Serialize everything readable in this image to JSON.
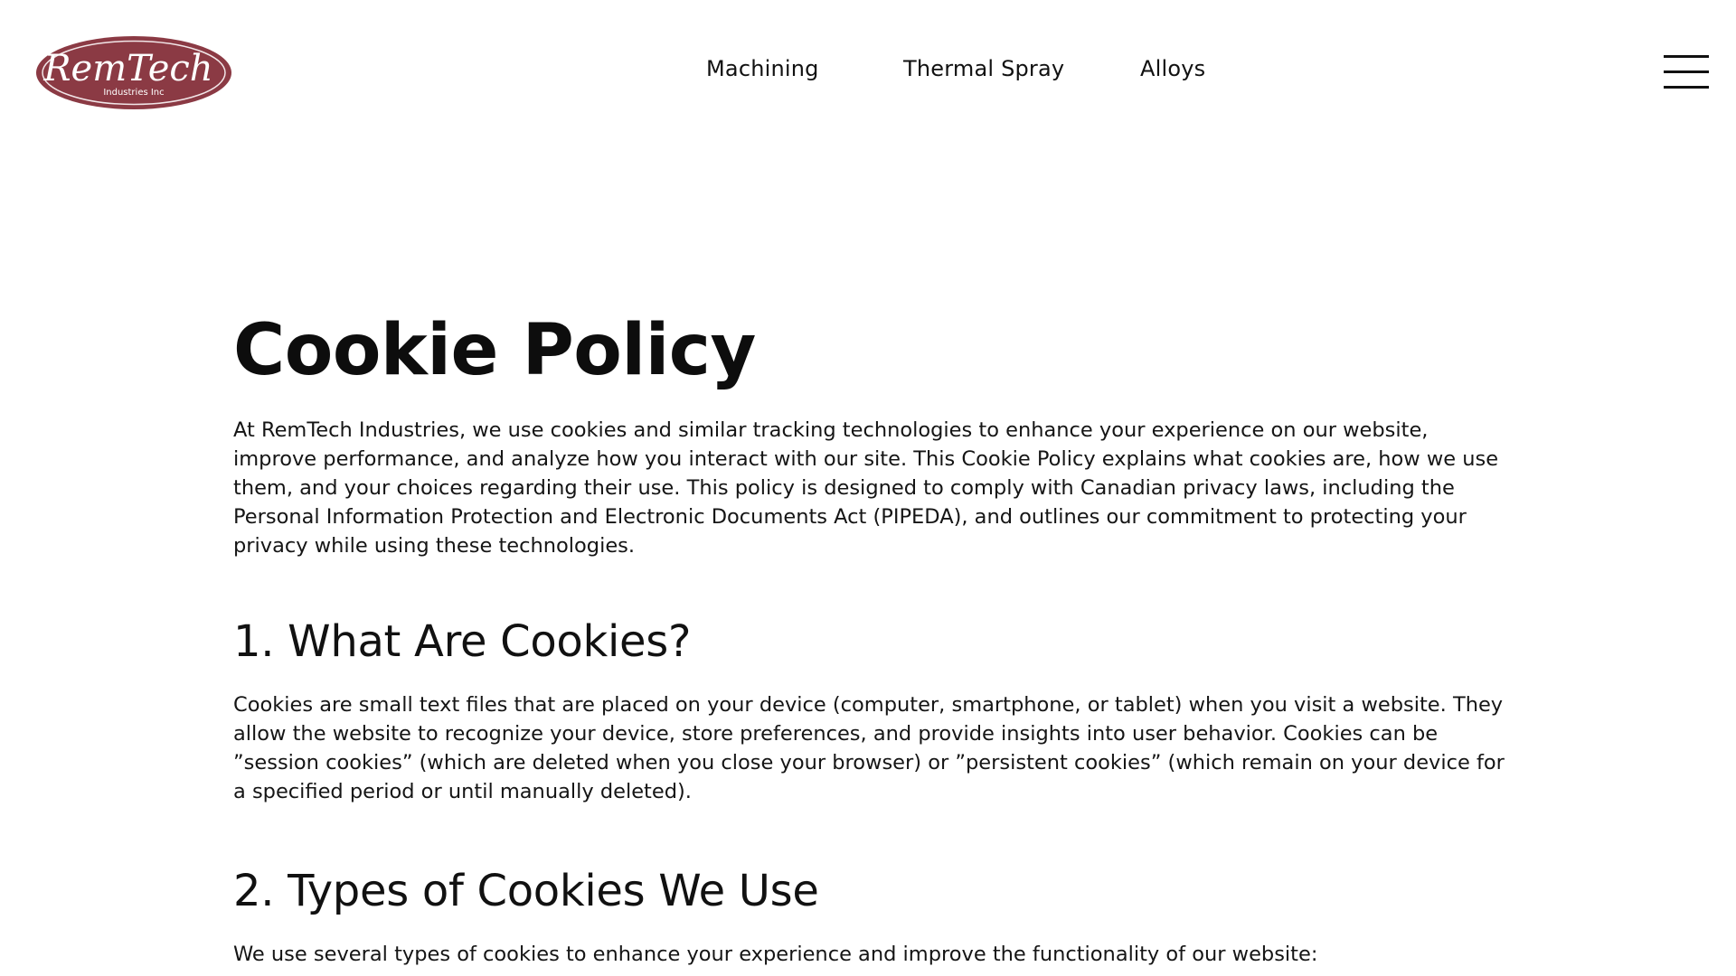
{
  "header": {
    "logo": {
      "brand": "RemTech",
      "subtitle": "Industries Inc",
      "color": "#8b3a44"
    },
    "nav": [
      {
        "label": "Machining"
      },
      {
        "label": "Thermal Spray"
      },
      {
        "label": "Alloys"
      }
    ],
    "menu_icon": "hamburger-icon"
  },
  "main": {
    "title": "Cookie Policy",
    "intro": "At RemTech Industries, we use cookies and similar tracking technologies to enhance your experience on our website, improve performance, and analyze how you interact with our site. This Cookie Policy explains what cookies are, how we use them, and your choices regarding their use. This policy is designed to comply with Canadian privacy laws, including the Personal Information Protection and Electronic Documents Act (PIPEDA), and outlines our commitment to protecting your privacy while using these technologies.",
    "sections": [
      {
        "heading": "1. What Are Cookies?",
        "body": "Cookies are small text files that are placed on your device (computer, smartphone, or tablet) when you visit a website. They allow the website to recognize your device, store preferences, and provide insights into user behavior. Cookies can be ”session cookies” (which are deleted when you close your browser) or ”persistent cookies” (which remain on your device for a specified period or until manually deleted)."
      },
      {
        "heading": "2. Types of Cookies We Use",
        "body": "We use several types of cookies to enhance your experience and improve the functionality of our website:"
      }
    ]
  }
}
